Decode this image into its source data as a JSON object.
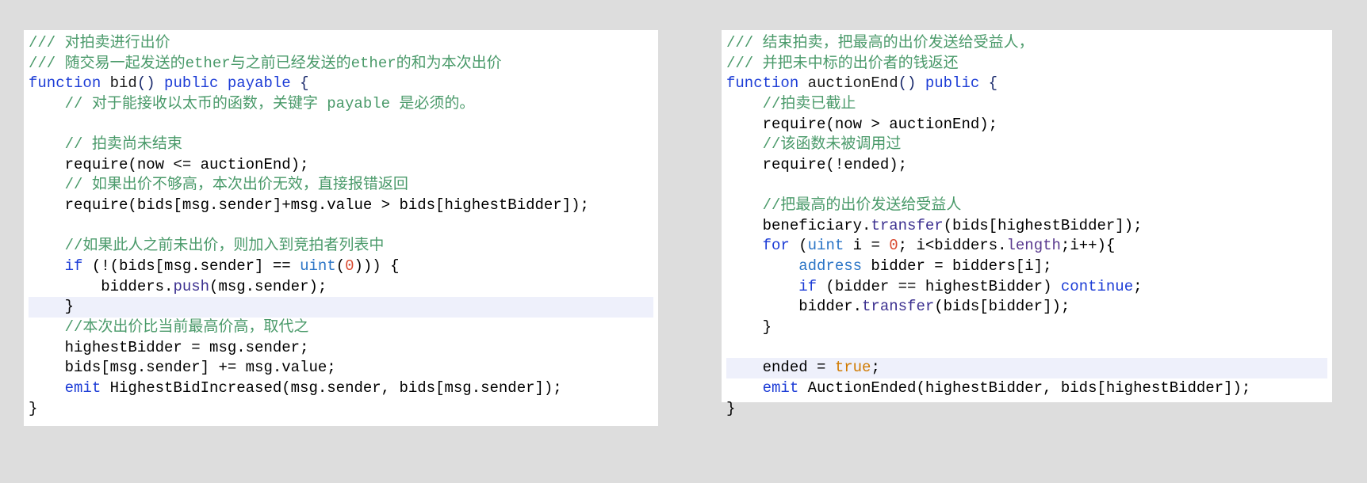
{
  "left": {
    "l01": "/// 对拍卖进行出价",
    "l02": "/// 随交易一起发送的ether与之前已经发送的ether的和为本次出价",
    "l03_kw1": "function",
    "l03_name": " bid",
    "l03_p": "()",
    "l03_kw2": " public",
    "l03_kw3": " payable",
    "l03_brace": " {",
    "l04": "    // 对于能接收以太币的函数，关键字 payable 是必须的。",
    "l05": "",
    "l06": "    // 拍卖尚未结束",
    "l07": "    require(now <= auctionEnd);",
    "l08": "    // 如果出价不够高，本次出价无效，直接报错返回",
    "l09": "    require(bids[msg.sender]+msg.value > bids[highestBidder]);",
    "l10": "",
    "l11": "    //如果此人之前未出价，则加入到竞拍者列表中",
    "l12_if": "    if",
    "l12_cond_a": " (!(bids[msg.sender] == ",
    "l12_uint": "uint",
    "l12_paren": "(",
    "l12_zero": "0",
    "l12_cond_b": "))) {",
    "l13_a": "        bidders.",
    "l13_push": "push",
    "l13_b": "(msg.sender);",
    "l14": "    }",
    "l15": "    //本次出价比当前最高价高，取代之",
    "l16": "    highestBidder = msg.sender;",
    "l17": "    bids[msg.sender] += msg.value;",
    "l18_emit": "    emit",
    "l18_rest": " HighestBidIncreased(msg.sender, bids[msg.sender]);",
    "l19": "}"
  },
  "right": {
    "r01": "/// 结束拍卖，把最高的出价发送给受益人，",
    "r02": "/// 并把未中标的出价者的钱返还",
    "r03_kw1": "function",
    "r03_name": " auctionEnd",
    "r03_p": "()",
    "r03_kw2": " public",
    "r03_brace": " {",
    "r04": "    //拍卖已截止",
    "r05": "    require(now > auctionEnd);",
    "r06": "    //该函数未被调用过",
    "r07": "    require(!ended);",
    "r08": "",
    "r09": "    //把最高的出价发送给受益人",
    "r10_a": "    beneficiary.",
    "r10_transfer": "transfer",
    "r10_b": "(bids[highestBidder]);",
    "r11_for": "    for",
    "r11_a": " (",
    "r11_uint": "uint",
    "r11_b": " i = ",
    "r11_zero": "0",
    "r11_c": "; i<bidders.",
    "r11_len": "length",
    "r11_d": ";i++){",
    "r12_addr": "        address",
    "r12_rest": " bidder = bidders[i];",
    "r13_if": "        if",
    "r13_cond": " (bidder == highestBidder) ",
    "r13_cont": "continue",
    "r13_end": ";",
    "r14_a": "        bidder.",
    "r14_transfer": "transfer",
    "r14_b": "(bids[bidder]);",
    "r15": "    }",
    "r16": "",
    "r17_a": "    ended = ",
    "r17_true": "true",
    "r17_b": ";",
    "r18_emit": "    emit",
    "r18_rest": " AuctionEnded(highestBidder, bids[highestBidder]);",
    "r19": "}"
  }
}
